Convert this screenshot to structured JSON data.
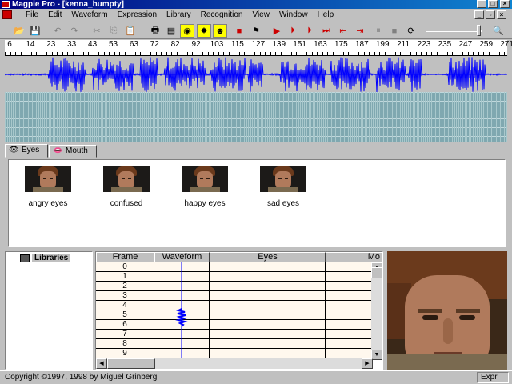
{
  "window": {
    "title": "Magpie Pro - [kenna_humpty]",
    "controls": [
      "_",
      "□",
      "×"
    ]
  },
  "menu": [
    "File",
    "Edit",
    "Waveform",
    "Expression",
    "Library",
    "Recognition",
    "View",
    "Window",
    "Help"
  ],
  "mdi_controls": [
    "_",
    "▫",
    "×"
  ],
  "toolbar": {
    "buttons": [
      {
        "name": "open-icon",
        "glyph": "📂"
      },
      {
        "name": "save-icon",
        "glyph": "💾"
      },
      {
        "name": "undo-icon",
        "glyph": "↶"
      },
      {
        "name": "redo-icon",
        "glyph": "↷"
      },
      {
        "name": "cut-icon",
        "glyph": "✂"
      },
      {
        "name": "copy-icon",
        "glyph": "⎘"
      },
      {
        "name": "paste-icon",
        "glyph": "📋"
      },
      {
        "name": "print-icon",
        "glyph": "🖶"
      },
      {
        "name": "film-icon",
        "glyph": "▤"
      },
      {
        "name": "face-tool-icon",
        "glyph": "◉"
      },
      {
        "name": "sparkle-icon",
        "glyph": "✸"
      },
      {
        "name": "people-icon",
        "glyph": "☻"
      },
      {
        "name": "record-icon",
        "glyph": "■"
      },
      {
        "name": "dictionary-icon",
        "glyph": "⚑"
      },
      {
        "name": "play-icon",
        "glyph": "▶"
      },
      {
        "name": "play-selection-icon",
        "glyph": "⏵"
      },
      {
        "name": "play-loop-icon",
        "glyph": "⏵"
      },
      {
        "name": "play-to-end-icon",
        "glyph": "⏭"
      },
      {
        "name": "goto-start-icon",
        "glyph": "⇤"
      },
      {
        "name": "goto-end-icon",
        "glyph": "⇥"
      },
      {
        "name": "pause-icon",
        "glyph": "⏸"
      },
      {
        "name": "stop-icon",
        "glyph": "■"
      },
      {
        "name": "loop-icon",
        "glyph": "⟳"
      },
      {
        "name": "zoom-icon",
        "glyph": "🔍"
      }
    ]
  },
  "ruler": {
    "ticks": [
      "6",
      "14",
      "23",
      "33",
      "43",
      "53",
      "63",
      "72",
      "82",
      "92",
      "103",
      "115",
      "127",
      "139",
      "151",
      "163",
      "175",
      "187",
      "199",
      "211",
      "223",
      "235",
      "247",
      "259",
      "271"
    ]
  },
  "tabs": [
    {
      "label": "Eyes",
      "icon": "eye-icon",
      "glyph": "👁"
    },
    {
      "label": "Mouth",
      "icon": "lips-icon",
      "glyph": "👄"
    }
  ],
  "expressions": [
    "angry eyes",
    "confused",
    "happy eyes",
    "sad eyes"
  ],
  "libraries": {
    "label": "Libraries"
  },
  "grid": {
    "columns": [
      "Frame",
      "Waveform",
      "Eyes",
      "Mo"
    ],
    "frames": [
      "0",
      "1",
      "2",
      "3",
      "4",
      "5",
      "6",
      "7",
      "8",
      "9"
    ]
  },
  "status": {
    "copyright": "Copyright ©1997, 1998 by Miguel Grinberg",
    "right": "Expr"
  },
  "colors": {
    "waveform": "#0000ff",
    "timeline": "#7fa8b0",
    "titlebar": "#000080",
    "grid_body": "#fff8ee"
  }
}
